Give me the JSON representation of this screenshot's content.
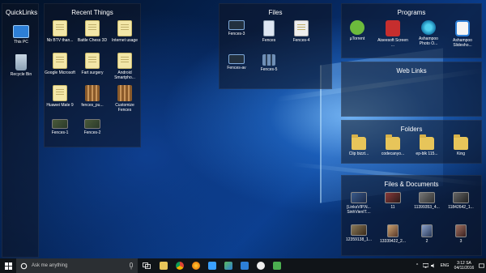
{
  "desktop": {
    "quicklinks": {
      "title": "QuickLinks",
      "items": [
        {
          "label": "This PC",
          "icon": "monitor-icon"
        },
        {
          "label": "Recycle Bin",
          "icon": "recycle-bin-icon"
        }
      ]
    },
    "recent_things": {
      "title": "Recent Things",
      "items": [
        {
          "label": "Nb BTV than...",
          "icon": "document-icon"
        },
        {
          "label": "Battle Chess 3D",
          "icon": "document-icon"
        },
        {
          "label": "Internet usage",
          "icon": "document-icon"
        },
        {
          "label": "Google Microsoft",
          "icon": "document-icon"
        },
        {
          "label": "Fart surgery",
          "icon": "document-icon"
        },
        {
          "label": "Android Smartpho...",
          "icon": "document-icon"
        },
        {
          "label": "Huawei Mate 9",
          "icon": "document-icon"
        },
        {
          "label": "fences_pu...",
          "icon": "fences-icon"
        },
        {
          "label": "Customize Fences",
          "icon": "fences-icon"
        },
        {
          "label": "Fences-1",
          "icon": "image-icon"
        },
        {
          "label": "Fences-2",
          "icon": "image-icon"
        }
      ]
    },
    "files": {
      "title": "Files",
      "items": [
        {
          "label": "Fences-3",
          "icon": "image-icon"
        },
        {
          "label": "Fences",
          "icon": "exe-icon"
        },
        {
          "label": "Fences-4",
          "icon": "document-icon"
        },
        {
          "label": "Fences-av",
          "icon": "image-icon"
        },
        {
          "label": "Fences-5",
          "icon": "image-icon"
        }
      ]
    },
    "programs": {
      "title": "Programs",
      "items": [
        {
          "label": "µTorrent",
          "icon": "utorrent-icon"
        },
        {
          "label": "Aiseesoft Screen ...",
          "icon": "aiseesoft-icon"
        },
        {
          "label": "Ashampoo Photo O...",
          "icon": "ashampoo-photo-icon"
        },
        {
          "label": "Ashampoo Slidesho...",
          "icon": "ashampoo-slideshow-icon"
        }
      ]
    },
    "web_links": {
      "title": "Web Links"
    },
    "folders": {
      "title": "Folders",
      "items": [
        {
          "label": "Clip bizzt...",
          "icon": "folder-icon"
        },
        {
          "label": "codecanyo...",
          "icon": "folder-icon"
        },
        {
          "label": "ep-blk 115...",
          "icon": "folder-icon"
        },
        {
          "label": "King",
          "icon": "folder-icon"
        }
      ]
    },
    "files_documents": {
      "title": "Files & Documents",
      "items": [
        {
          "label": "[LinksVIP.N... SinhVienIT....",
          "icon": "video-icon"
        },
        {
          "label": "11",
          "icon": "video-icon"
        },
        {
          "label": "11399353_4...",
          "icon": "image-icon"
        },
        {
          "label": "11842642_1...",
          "icon": "image-icon"
        },
        {
          "label": "12359138_1...",
          "icon": "image-icon"
        },
        {
          "label": "13339422_2...",
          "icon": "image-icon"
        },
        {
          "label": "2",
          "icon": "image-icon"
        },
        {
          "label": "3",
          "icon": "image-icon"
        }
      ]
    }
  },
  "taskbar": {
    "search_placeholder": "Ask me anything",
    "apps": [
      "file-explorer-icon",
      "chrome-icon",
      "firefox-icon",
      "mail-icon",
      "maps-icon",
      "store-icon",
      "edge-icon",
      "music-icon"
    ],
    "language": "ENG",
    "time": "3:12 SA",
    "date": "04/11/2016"
  },
  "colors": {
    "fence_bg": "#0f1423",
    "taskbar_bg": "#101418",
    "accent": "#3aa0ff"
  }
}
